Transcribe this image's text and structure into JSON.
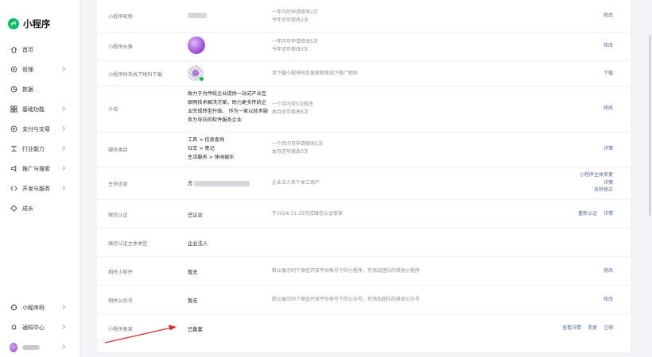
{
  "app": {
    "name": "小程序"
  },
  "nav": [
    {
      "label": "首页",
      "icon": "home-icon",
      "has_chevron": false
    },
    {
      "label": "管理",
      "icon": "manage-icon",
      "has_chevron": true
    },
    {
      "label": "数据",
      "icon": "data-icon",
      "has_chevron": false
    },
    {
      "label": "基础功能",
      "icon": "grid-icon",
      "has_chevron": true
    },
    {
      "label": "支付与交易",
      "icon": "pay-icon",
      "has_chevron": true
    },
    {
      "label": "行业能力",
      "icon": "industry-icon",
      "has_chevron": true
    },
    {
      "label": "推广与搜索",
      "icon": "promote-icon",
      "has_chevron": true
    },
    {
      "label": "开发与服务",
      "icon": "dev-icon",
      "has_chevron": true
    },
    {
      "label": "成长",
      "icon": "growth-icon",
      "has_chevron": false
    }
  ],
  "nav_bottom": [
    {
      "label": "小程序码",
      "icon": "qrcode-icon"
    },
    {
      "label": "通知中心",
      "icon": "bell-icon"
    }
  ],
  "rows": {
    "name": {
      "label": "小程序昵称",
      "desc1": "一年内可申请修改2次",
      "desc2": "今年还可修改2次",
      "action": "修改"
    },
    "avatar": {
      "label": "小程序头像",
      "desc1": "一年内可申请修改5次",
      "desc2": "今年还可修改5次",
      "action": "修改"
    },
    "qrcode": {
      "label": "小程序码及线下物料下载",
      "desc1": "可下载小程序码及搜索框等线下推广物料",
      "action": "下载"
    },
    "intro": {
      "label": "介绍",
      "value_lines": [
        "致力于为传统企业提供一站式产业互",
        "联网技术解决方案，助力更多传统企",
        "业完成转型升级。 作为一家以技术服",
        "务为导向的软件服务企业"
      ],
      "desc1": "一个月内可5次修改",
      "desc2": "本月还可修改5次",
      "action": "修改"
    },
    "category": {
      "label": "服务类目",
      "value_lines": [
        "工具 > 信息查询",
        "社交 > 笔记",
        "生活服务 > 休闲娱乐"
      ],
      "desc1": "一个月内可申请修改5次",
      "desc2": "本月还可修改5次",
      "action": "详情"
    },
    "subject": {
      "label": "主体信息",
      "value_prefix": "去",
      "desc1": "企业法人及个体工商户",
      "actions": [
        "小程序主体变更",
        "详情",
        "名称修正"
      ]
    },
    "verify": {
      "label": "微信认证",
      "value": "已认证",
      "desc1": "于2024-11-25完成微信认证审核",
      "actions": [
        "重新认证",
        "详情"
      ]
    },
    "verify_type": {
      "label": "微信认证主体类型",
      "value": "企业法人"
    },
    "related_app": {
      "label": "相关小程序",
      "value": "暂无",
      "desc1": "默认展示同个微信开放平台帐号下的小程序，可添加团队的其他小程序",
      "action": "修改"
    },
    "related_oa": {
      "label": "相关公众号",
      "value": "暂无",
      "desc1": "默认展示同个微信开放平台帐号下的公众号，可添加团队的其他公众号",
      "action": "修改"
    },
    "filing": {
      "label": "小程序备案",
      "value": "已备案",
      "actions": [
        "查看详情",
        "变更",
        "注销"
      ]
    }
  },
  "colors": {
    "brand": "#07c160",
    "link": "#576b95",
    "arrow": "#d9302c"
  }
}
